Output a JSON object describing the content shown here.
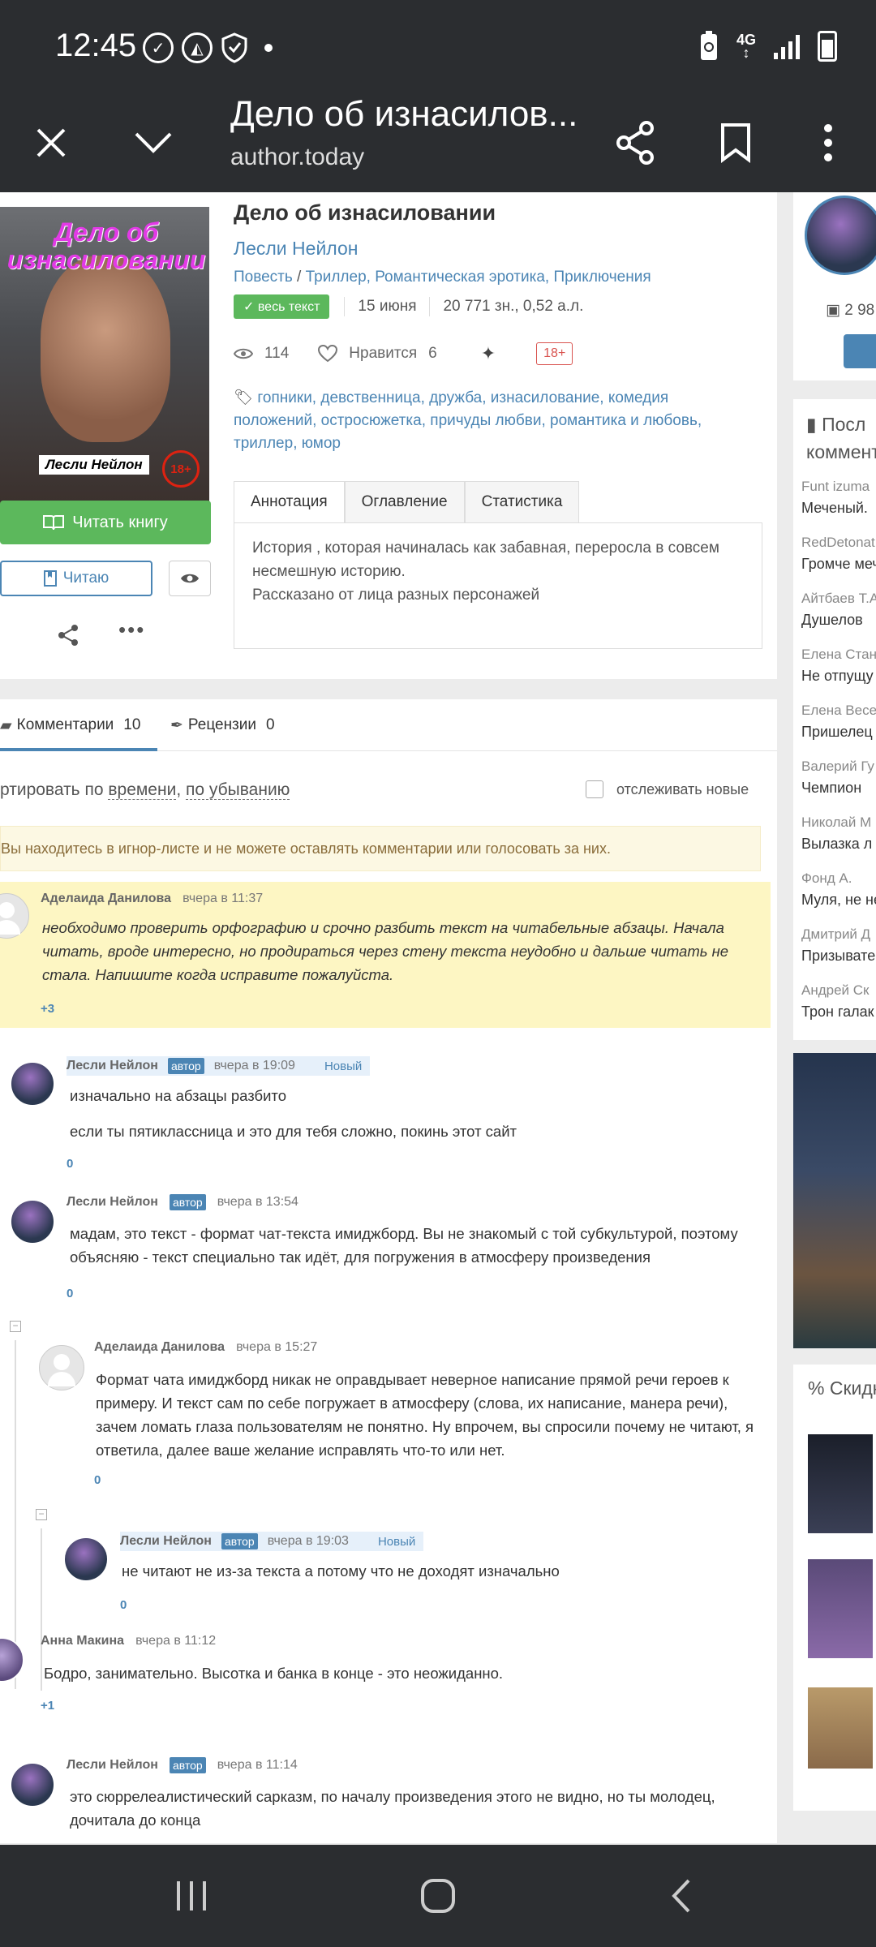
{
  "status_bar": {
    "time": "12:45",
    "network": "4G",
    "icons": [
      "check-circle-icon",
      "app-icon",
      "shield-icon",
      "dot-icon",
      "recycle-battery-icon",
      "signal-icon",
      "battery-icon"
    ]
  },
  "app_bar": {
    "title": "Дело об изнасилов...",
    "url": "author.today",
    "icons": [
      "close-icon",
      "chevron-down-icon",
      "share-icon",
      "bookmark-icon",
      "more-vert-icon"
    ]
  },
  "book": {
    "cover_title": "Дело об изнасиловании",
    "cover_author": "Лесли Нейлон",
    "cover_age": "18+",
    "title": "Дело об изнасиловании",
    "author": "Лесли Нейлон",
    "form": "Повесть",
    "genres_sep": " / ",
    "genres": "Триллер, Романтическая эротика, Приключения",
    "status_badge": "весь текст",
    "date": "15 июня",
    "size": "20 771 зн., 0,52 а.л.",
    "views": "114",
    "likes_label": "Нравится",
    "likes": "6",
    "age_badge": "18+",
    "tags": "гопники, девственница, дружба, изнасилование, комедия положений, остросюжетка, причуды любви, романтика и любовь, триллер, юмор",
    "read_button": "Читать книгу",
    "reading_button": "Читаю"
  },
  "book_tabs": [
    "Аннотация",
    "Оглавление",
    "Статистика"
  ],
  "annotation": {
    "line1": "История , которая начиналась как забавная, переросла в совсем несмешную историю.",
    "line2": "Рассказано от лица разных персонажей"
  },
  "comments_tabs": {
    "comments_label": "Комментарии",
    "comments_count": "10",
    "reviews_label": "Рецензии",
    "reviews_count": "0"
  },
  "sort": {
    "prefix": "ртировать по",
    "by_time": "времени",
    "by_order": "по убыванию",
    "follow_label": "отслеживать новые"
  },
  "warning": "Вы находитесь в игнор-листе и не можете оставлять комментарии или голосовать за них.",
  "comments": [
    {
      "author": "Аделаида Данилова",
      "time": "вчера в 11:37",
      "text": "необходимо проверить орфографию и срочно разбить текст на читабельные абзацы. Начала читать, вроде интересно, но продираться через стену текста неудобно и дальше читать не стала. Напишите когда исправите пожалуйста.",
      "votes": "+3"
    },
    {
      "author": "Лесли Нейлон",
      "badge": "автор",
      "time": "вчера в 19:09",
      "new_label": "Новый",
      "text1": "изначально на абзацы разбито",
      "text2": "если ты пятиклассница и это для тебя сложно, покинь этот сайт",
      "votes": "0"
    },
    {
      "author": "Лесли Нейлон",
      "badge": "автор",
      "time": "вчера в 13:54",
      "text": "мадам, это текст - формат чат-текста имиджборд. Вы не знакомый с той субкультурой, поэтому объясняю - текст специально так идёт, для погружения в атмосферу произведения",
      "votes": "0"
    },
    {
      "author": "Аделаида Данилова",
      "time": "вчера в 15:27",
      "text": "Формат чата имиджборд никак не оправдывает неверное написание прямой речи героев к примеру. И текст сам по себе погружает в атмосферу (слова, их написание, манера речи), зачем ломать глаза пользователям не понятно. Ну впрочем, вы спросили почему не читают, я ответила, далее ваше желание исправлять что-то или нет.",
      "votes": "0"
    },
    {
      "author": "Лесли Нейлон",
      "badge": "автор",
      "time": "вчера в 19:03",
      "new_label": "Новый",
      "text": "не читают не из-за текста а потому что не доходят изначально",
      "votes": "0"
    },
    {
      "author": "Анна Макина",
      "time": "вчера в 11:12",
      "text": "Бодро, занимательно. Высотка и банка в конце - это неожиданно.",
      "votes": "+1"
    },
    {
      "author": "Лесли Нейлон",
      "badge": "автор",
      "time": "вчера в 11:14",
      "text": "это сюррелеалистический сарказм, по началу произведения этого не видно, но ты молодец, дочитала до конца"
    }
  ],
  "sidebar": {
    "views_count": "2 98",
    "last_comments_heading_1": "Посл",
    "last_comments_heading_2": "коммент",
    "items": [
      {
        "name": "Funt izuma",
        "title": "Меченый. "
      },
      {
        "name": "RedDetonat",
        "title": "Громче меч"
      },
      {
        "name": "Айтбаев Т.А",
        "title": "Душелов"
      },
      {
        "name": "Елена Стан",
        "title": "Не отпущу"
      },
      {
        "name": "Елена Весе",
        "title": "Пришелец"
      },
      {
        "name": "Валерий Гу",
        "title": "Чемпион"
      },
      {
        "name": "Николай М",
        "title": "Вылазка л"
      },
      {
        "name": "Фонд А.",
        "title": "Муля, не не"
      },
      {
        "name": "Дмитрий Д",
        "title": "Призывате"
      },
      {
        "name": "Андрей Ск",
        "title": "Трон галак"
      }
    ],
    "discount_heading": "% Скидк"
  }
}
